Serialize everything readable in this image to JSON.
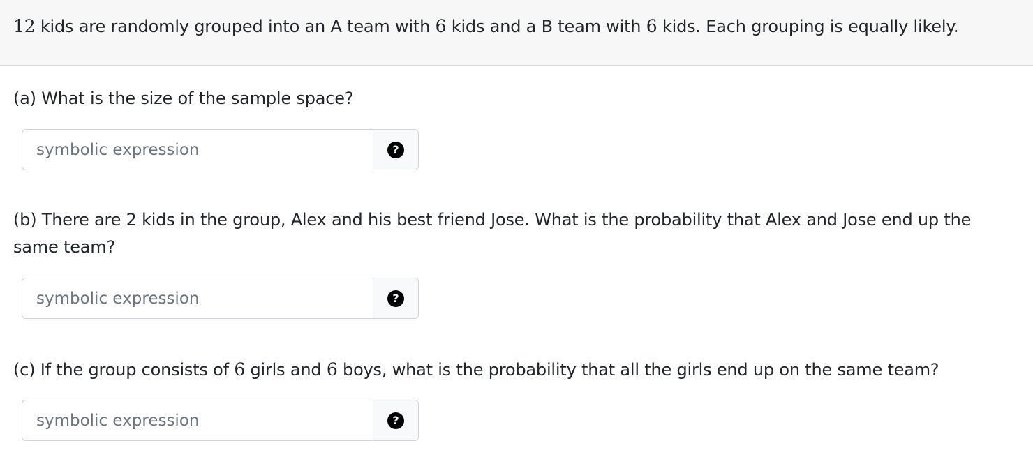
{
  "intro": {
    "n_total": "12",
    "text1": "kids are randomly grouped into an A team with",
    "n_a": "6",
    "text2": "kids and a B team with",
    "n_b": "6",
    "text3": "kids. Each grouping is equally likely."
  },
  "parts": [
    {
      "question": "(a) What is the size of the sample space?",
      "placeholder": "symbolic expression",
      "help_icon": "question-circle-icon"
    },
    {
      "question": "(b) There are 2 kids in the group, Alex and his best friend Jose. What is the probability that Alex and Jose end up the same team?",
      "placeholder": "symbolic expression",
      "help_icon": "question-circle-icon"
    },
    {
      "question_pre": "(c) If the group consists of",
      "n_girls": "6",
      "question_mid": "girls and",
      "n_boys": "6",
      "question_post": "boys, what is the probability that all the girls end up on the same team?",
      "placeholder": "symbolic expression",
      "help_icon": "question-circle-icon"
    }
  ],
  "help_glyph": "?"
}
